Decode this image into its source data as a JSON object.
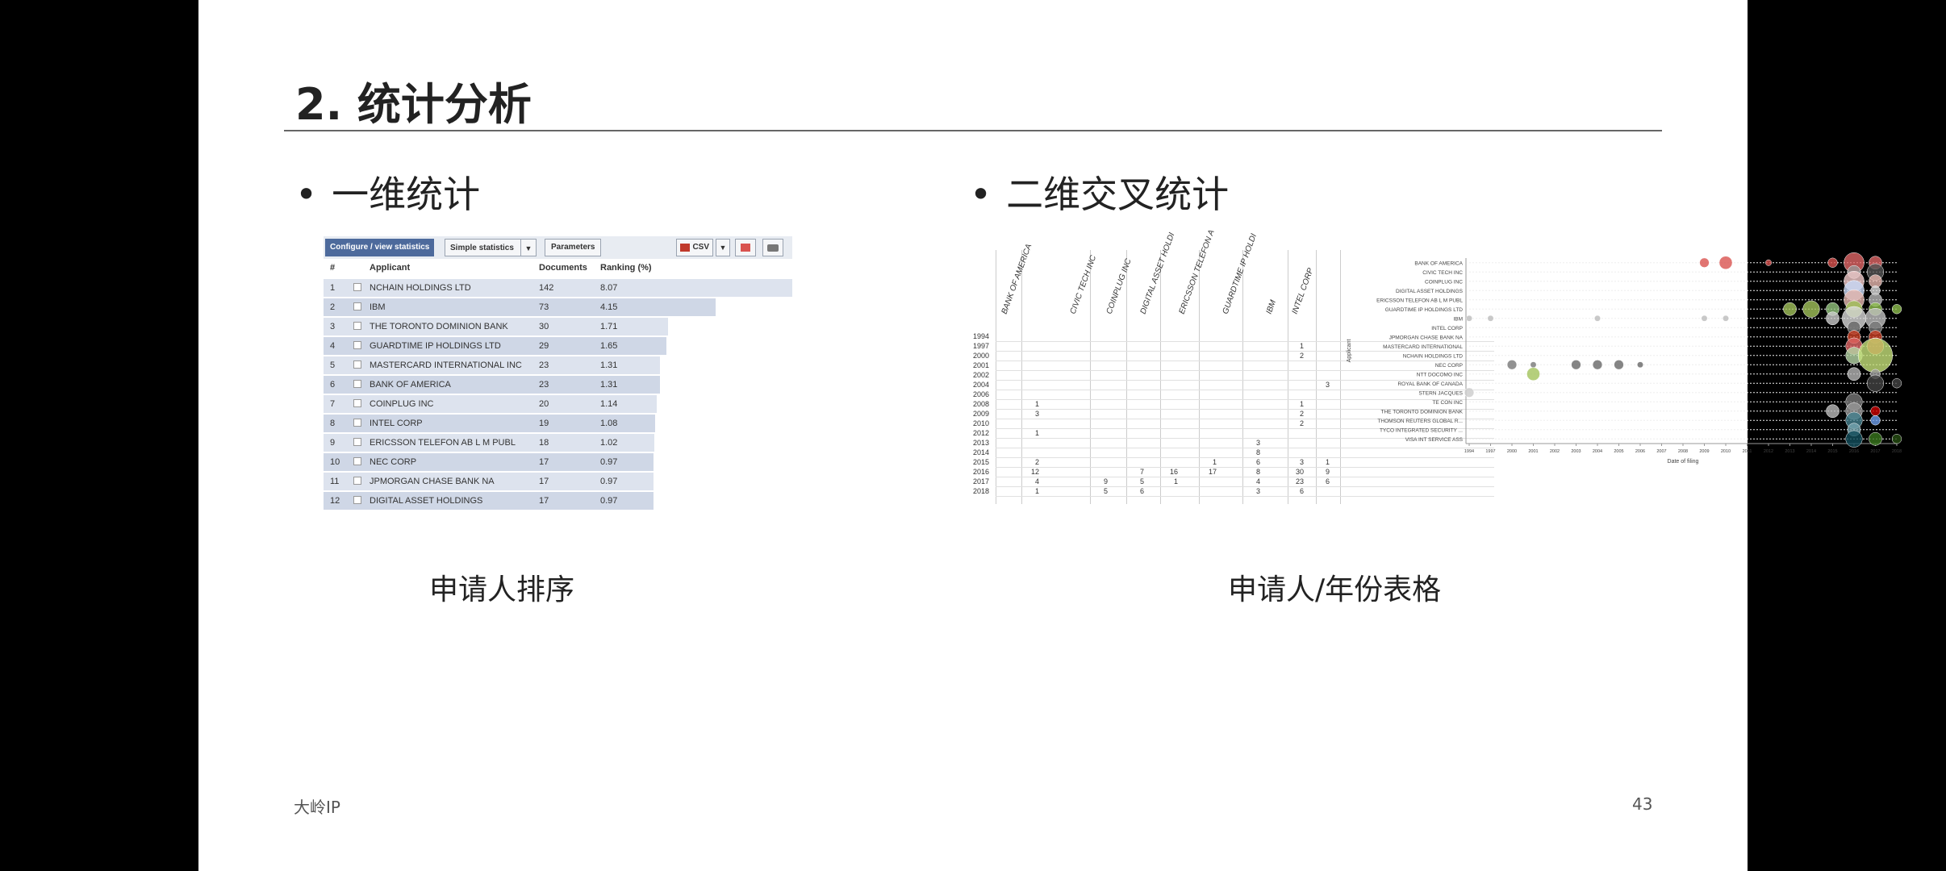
{
  "slide": {
    "title": "2. 统计分析",
    "bullet_left": "一维统计",
    "bullet_right": "二维交叉统计",
    "bullet_symbol": "•",
    "caption_left": "申请人排序",
    "caption_right": "申请人/年份表格",
    "footer_left": "大岭IP",
    "page_number": "43"
  },
  "stats_panel": {
    "config_label": "Configure / view statistics",
    "simple_label": "Simple statistics",
    "dropdown_arrow": "▼",
    "params_label": "Parameters",
    "csv_label": "CSV",
    "headers": {
      "num": "#",
      "applicant": "Applicant",
      "documents": "Documents",
      "ranking": "Ranking (%)"
    },
    "rows": [
      {
        "num": "1",
        "applicant": "NCHAIN HOLDINGS LTD",
        "documents": "142",
        "ranking": "8.07",
        "share": 8.07
      },
      {
        "num": "2",
        "applicant": "IBM",
        "documents": "73",
        "ranking": "4.15",
        "share": 4.15
      },
      {
        "num": "3",
        "applicant": "THE TORONTO DOMINION BANK",
        "documents": "30",
        "ranking": "1.71",
        "share": 1.71
      },
      {
        "num": "4",
        "applicant": "GUARDTIME IP HOLDINGS LTD",
        "documents": "29",
        "ranking": "1.65",
        "share": 1.65
      },
      {
        "num": "5",
        "applicant": "MASTERCARD INTERNATIONAL INC",
        "documents": "23",
        "ranking": "1.31",
        "share": 1.31
      },
      {
        "num": "6",
        "applicant": "BANK OF AMERICA",
        "documents": "23",
        "ranking": "1.31",
        "share": 1.31
      },
      {
        "num": "7",
        "applicant": "COINPLUG INC",
        "documents": "20",
        "ranking": "1.14",
        "share": 1.14
      },
      {
        "num": "8",
        "applicant": "INTEL CORP",
        "documents": "19",
        "ranking": "1.08",
        "share": 1.08
      },
      {
        "num": "9",
        "applicant": "ERICSSON TELEFON AB L M PUBL",
        "documents": "18",
        "ranking": "1.02",
        "share": 1.02
      },
      {
        "num": "10",
        "applicant": "NEC CORP",
        "documents": "17",
        "ranking": "0.97",
        "share": 0.97
      },
      {
        "num": "11",
        "applicant": "JPMORGAN CHASE BANK NA",
        "documents": "17",
        "ranking": "0.97",
        "share": 0.97
      },
      {
        "num": "12",
        "applicant": "DIGITAL ASSET HOLDINGS",
        "documents": "17",
        "ranking": "0.97",
        "share": 0.97
      }
    ]
  },
  "cross_table": {
    "columns": [
      "BANK OF AMERICA",
      "CIVIC TECH INC",
      "COINPLUG INC",
      "DIGITAL ASSET HOLDI",
      "ERICSSON TELEFON A",
      "GUARDTIME IP HOLDI",
      "IBM",
      "INTEL CORP"
    ],
    "years": [
      "1994",
      "1997",
      "2000",
      "2001",
      "2002",
      "2004",
      "2006",
      "2008",
      "2009",
      "2010",
      "2012",
      "2013",
      "2014",
      "2015",
      "2016",
      "2017",
      "2018"
    ],
    "cells": [
      {
        "year": "1997",
        "col": 6,
        "value": "1"
      },
      {
        "year": "2000",
        "col": 6,
        "value": "2"
      },
      {
        "year": "2004",
        "col": 7,
        "value": "3"
      },
      {
        "year": "2008",
        "col": 0,
        "value": "1"
      },
      {
        "year": "2008",
        "col": 6,
        "value": "1"
      },
      {
        "year": "2009",
        "col": 0,
        "value": "3"
      },
      {
        "year": "2009",
        "col": 6,
        "value": "2"
      },
      {
        "year": "2010",
        "col": 6,
        "value": "2"
      },
      {
        "year": "2012",
        "col": 0,
        "value": "1"
      },
      {
        "year": "2013",
        "col": 5,
        "value": "3"
      },
      {
        "year": "2014",
        "col": 5,
        "value": "8"
      },
      {
        "year": "2015",
        "col": 0,
        "value": "2"
      },
      {
        "year": "2015",
        "col": 4,
        "value": "1"
      },
      {
        "year": "2015",
        "col": 5,
        "value": "6"
      },
      {
        "year": "2015",
        "col": 6,
        "value": "3"
      },
      {
        "year": "2015",
        "col": 7,
        "value": "1"
      },
      {
        "year": "2016",
        "col": 0,
        "value": "12"
      },
      {
        "year": "2016",
        "col": 2,
        "value": "7"
      },
      {
        "year": "2016",
        "col": 3,
        "value": "16"
      },
      {
        "year": "2016",
        "col": 4,
        "value": "17"
      },
      {
        "year": "2016",
        "col": 5,
        "value": "8"
      },
      {
        "year": "2016",
        "col": 6,
        "value": "30"
      },
      {
        "year": "2016",
        "col": 7,
        "value": "9"
      },
      {
        "year": "2017",
        "col": 0,
        "value": "4"
      },
      {
        "year": "2017",
        "col": 1,
        "value": "9"
      },
      {
        "year": "2017",
        "col": 2,
        "value": "5"
      },
      {
        "year": "2017",
        "col": 3,
        "value": "1"
      },
      {
        "year": "2017",
        "col": 5,
        "value": "4"
      },
      {
        "year": "2017",
        "col": 6,
        "value": "23"
      },
      {
        "year": "2017",
        "col": 7,
        "value": "6"
      },
      {
        "year": "2018",
        "col": 0,
        "value": "1"
      },
      {
        "year": "2018",
        "col": 1,
        "value": "5"
      },
      {
        "year": "2018",
        "col": 2,
        "value": "6"
      },
      {
        "year": "2018",
        "col": 5,
        "value": "3"
      },
      {
        "year": "2018",
        "col": 6,
        "value": "6"
      }
    ]
  },
  "chart_data": {
    "type": "scatter",
    "xlabel": "Date of filing",
    "ylabel": "Applicant",
    "x_ticks": [
      "1994",
      "1997",
      "2000",
      "2001",
      "2002",
      "2003",
      "2004",
      "2005",
      "2006",
      "2007",
      "2008",
      "2009",
      "2010",
      "2011",
      "2012",
      "2013",
      "2014",
      "2015",
      "2016",
      "2017",
      "2018"
    ],
    "categories": [
      "BANK OF AMERICA",
      "CIVIC TECH INC",
      "COINPLUG INC",
      "DIGITAL ASSET HOLDINGS",
      "ERICSSON TELEFON AB L M PUBL",
      "GUARDTIME IP HOLDINGS LTD",
      "IBM",
      "INTEL CORP",
      "JPMORGAN CHASE BANK NA",
      "MASTERCARD INTERNATIONAL",
      "NCHAIN HOLDINGS LTD",
      "NEC CORP",
      "NTT DOCOMO INC",
      "ROYAL BANK OF CANADA",
      "STERN JACQUES",
      "TE CON INC",
      "THE TORONTO DOMINION BANK",
      "THOMSON REUTERS GLOBAL R...",
      "TYCO INTEGRATED SECURITY ...",
      "VISA INT SERVICE ASS"
    ],
    "points": [
      {
        "row": 0,
        "x": "2009",
        "size": 2,
        "color": "#d9534f"
      },
      {
        "row": 0,
        "x": "2010",
        "size": 3,
        "color": "#d9534f"
      },
      {
        "row": 0,
        "x": "2012",
        "size": 1,
        "color": "#d9534f"
      },
      {
        "row": 0,
        "x": "2015",
        "size": 2,
        "color": "#d9534f"
      },
      {
        "row": 0,
        "x": "2016",
        "size": 5,
        "color": "#e06666"
      },
      {
        "row": 0,
        "x": "2017",
        "size": 3,
        "color": "#e06666"
      },
      {
        "row": 1,
        "x": "2016",
        "size": 3,
        "color": "#999999"
      },
      {
        "row": 1,
        "x": "2017",
        "size": 4,
        "color": "#555555"
      },
      {
        "row": 2,
        "x": "2016",
        "size": 5,
        "color": "#f4cccc"
      },
      {
        "row": 2,
        "x": "2017",
        "size": 3,
        "color": "#e6b8af"
      },
      {
        "row": 3,
        "x": "2016",
        "size": 5,
        "color": "#c9daf8"
      },
      {
        "row": 3,
        "x": "2017",
        "size": 2,
        "color": "#d9d9d9"
      },
      {
        "row": 4,
        "x": "2016",
        "size": 5,
        "color": "#e6b8af"
      },
      {
        "row": 4,
        "x": "2017",
        "size": 3,
        "color": "#b7b7b7"
      },
      {
        "row": 5,
        "x": "2013",
        "size": 3,
        "color": "#a2c35b"
      },
      {
        "row": 5,
        "x": "2014",
        "size": 4,
        "color": "#a2c35b"
      },
      {
        "row": 5,
        "x": "2015",
        "size": 3,
        "color": "#93c47d"
      },
      {
        "row": 5,
        "x": "2016",
        "size": 4,
        "color": "#a2c35b"
      },
      {
        "row": 5,
        "x": "2017",
        "size": 3,
        "color": "#8fbf4f"
      },
      {
        "row": 5,
        "x": "2018",
        "size": 2,
        "color": "#8fbf4f"
      },
      {
        "row": 6,
        "x": "1994",
        "size": 1,
        "color": "#bbbbbb"
      },
      {
        "row": 6,
        "x": "1997",
        "size": 1,
        "color": "#bbbbbb"
      },
      {
        "row": 6,
        "x": "2004",
        "size": 1,
        "color": "#bbbbbb"
      },
      {
        "row": 6,
        "x": "2009",
        "size": 1,
        "color": "#bbbbbb"
      },
      {
        "row": 6,
        "x": "2010",
        "size": 1,
        "color": "#bbbbbb"
      },
      {
        "row": 6,
        "x": "2015",
        "size": 3,
        "color": "#cccccc"
      },
      {
        "row": 6,
        "x": "2016",
        "size": 6,
        "color": "#d9d9d9"
      },
      {
        "row": 6,
        "x": "2017",
        "size": 5,
        "color": "#c0c0c0"
      },
      {
        "row": 7,
        "x": "2016",
        "size": 3,
        "color": "#666666"
      },
      {
        "row": 7,
        "x": "2017",
        "size": 3,
        "color": "#777777"
      },
      {
        "row": 8,
        "x": "2016",
        "size": 3,
        "color": "#cc4125"
      },
      {
        "row": 8,
        "x": "2017",
        "size": 3,
        "color": "#cc4125"
      },
      {
        "row": 9,
        "x": "2016",
        "size": 4,
        "color": "#e06666"
      },
      {
        "row": 9,
        "x": "2017",
        "size": 4,
        "color": "#cc0000"
      },
      {
        "row": 10,
        "x": "2016",
        "size": 4,
        "color": "#b6d7a8"
      },
      {
        "row": 10,
        "x": "2017",
        "size": 9,
        "color": "#c5e17a"
      },
      {
        "row": 11,
        "x": "2000",
        "size": 2,
        "color": "#777777"
      },
      {
        "row": 11,
        "x": "2001",
        "size": 1,
        "color": "#777777"
      },
      {
        "row": 11,
        "x": "2003",
        "size": 2,
        "color": "#666666"
      },
      {
        "row": 11,
        "x": "2004",
        "size": 2,
        "color": "#666666"
      },
      {
        "row": 11,
        "x": "2005",
        "size": 2,
        "color": "#666666"
      },
      {
        "row": 11,
        "x": "2006",
        "size": 1,
        "color": "#666666"
      },
      {
        "row": 12,
        "x": "2001",
        "size": 3,
        "color": "#a2c35b"
      },
      {
        "row": 12,
        "x": "2016",
        "size": 3,
        "color": "#b7b7b7"
      },
      {
        "row": 12,
        "x": "2017",
        "size": 2,
        "color": "#999999"
      },
      {
        "row": 13,
        "x": "2017",
        "size": 4,
        "color": "#444444"
      },
      {
        "row": 13,
        "x": "2018",
        "size": 2,
        "color": "#444444"
      },
      {
        "row": 14,
        "x": "1994",
        "size": 2,
        "color": "#cccccc"
      },
      {
        "row": 15,
        "x": "2016",
        "size": 4,
        "color": "#777777"
      },
      {
        "row": 16,
        "x": "2015",
        "size": 3,
        "color": "#bbbbbb"
      },
      {
        "row": 16,
        "x": "2016",
        "size": 4,
        "color": "#999999"
      },
      {
        "row": 16,
        "x": "2017",
        "size": 2,
        "color": "#cc0000"
      },
      {
        "row": 17,
        "x": "2016",
        "size": 4,
        "color": "#45818e"
      },
      {
        "row": 17,
        "x": "2017",
        "size": 2,
        "color": "#6d9eeb"
      },
      {
        "row": 18,
        "x": "2016",
        "size": 3,
        "color": "#76a5af"
      },
      {
        "row": 19,
        "x": "2016",
        "size": 4,
        "color": "#134f5c"
      },
      {
        "row": 19,
        "x": "2017",
        "size": 3,
        "color": "#38761d"
      },
      {
        "row": 19,
        "x": "2018",
        "size": 2,
        "color": "#274e13"
      }
    ]
  }
}
